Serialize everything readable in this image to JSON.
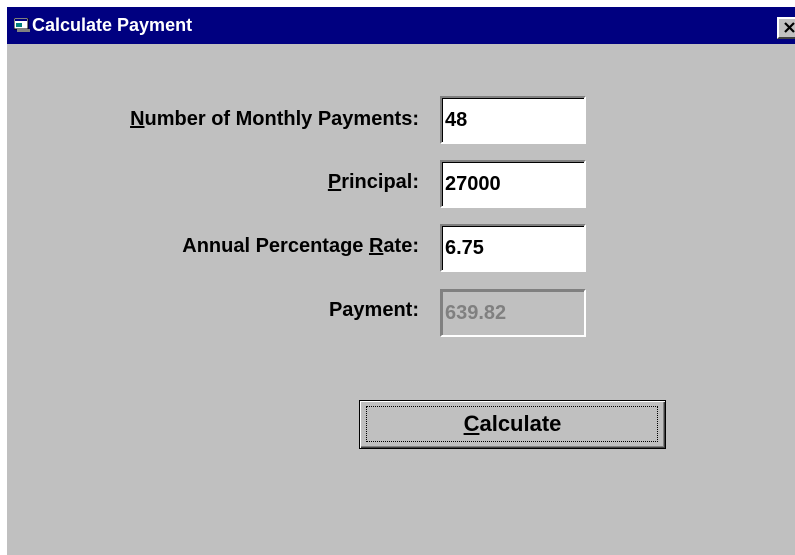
{
  "window": {
    "title": "Calculate Payment",
    "icon": "app-window-icon",
    "close_icon": "close-icon"
  },
  "form": {
    "payments_label": {
      "mnemonic": "N",
      "rest": "umber of Monthly Payments:"
    },
    "payments_value": "48",
    "principal_label": {
      "mnemonic": "P",
      "rest": "rincipal:"
    },
    "principal_value": "27000",
    "apr_label": {
      "before": "Annual Percentage ",
      "mnemonic": "R",
      "rest": "ate:"
    },
    "apr_value": "6.75",
    "payment_label": "Payment:",
    "payment_value": "639.82"
  },
  "actions": {
    "calculate": {
      "mnemonic": "C",
      "rest": "alculate"
    }
  },
  "colors": {
    "titlebar": "#000080",
    "face": "#c0c0c0",
    "disabled_text": "#808080"
  }
}
